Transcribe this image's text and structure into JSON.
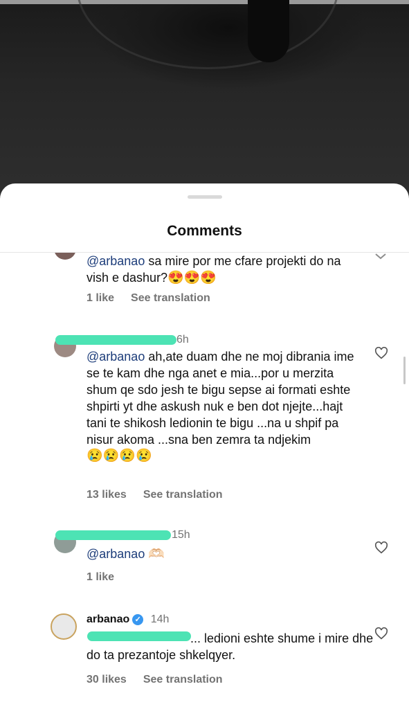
{
  "sheet": {
    "title": "Comments"
  },
  "comments": [
    {
      "text_mention": "@arbanao",
      "text_body": " sa mire por me cfare projekti do na vish e dashur?",
      "emojis": "😍😍😍",
      "likes": "1 like",
      "see_translation": "See translation"
    },
    {
      "time": "6h",
      "text_mention": "@arbanao",
      "text_body": " ah,ate duam dhe ne moj dibrania ime se te kam dhe nga anet e mia...por u merzita shum qe sdo jesh te bigu sepse ai formati eshte shpirti yt dhe askush nuk e ben dot njejte...hajt tani te shikosh ledionin te bigu ...na u shpif pa nisur akoma ...sna ben zemra ta ndjekim",
      "emojis": "😢😢😢😢",
      "likes": "13 likes",
      "see_translation": "See translation"
    },
    {
      "time": "15h",
      "text_mention": "@arbanao",
      "emojis": "🫶🏻",
      "likes": "1 like"
    },
    {
      "username": "arbanao",
      "verified": "✓",
      "time": "14h",
      "text_body": "... ledioni eshte shume i mire dhe do ta prezantoje shkelqyer.",
      "likes": "30 likes",
      "see_translation": "See translation"
    }
  ],
  "icons": {
    "like": "heart-outline-icon",
    "collapse": "chevron-down-icon"
  },
  "colors": {
    "redaction": "#4de3b4",
    "mention": "#1d3d7a",
    "verified": "#3897f0"
  }
}
